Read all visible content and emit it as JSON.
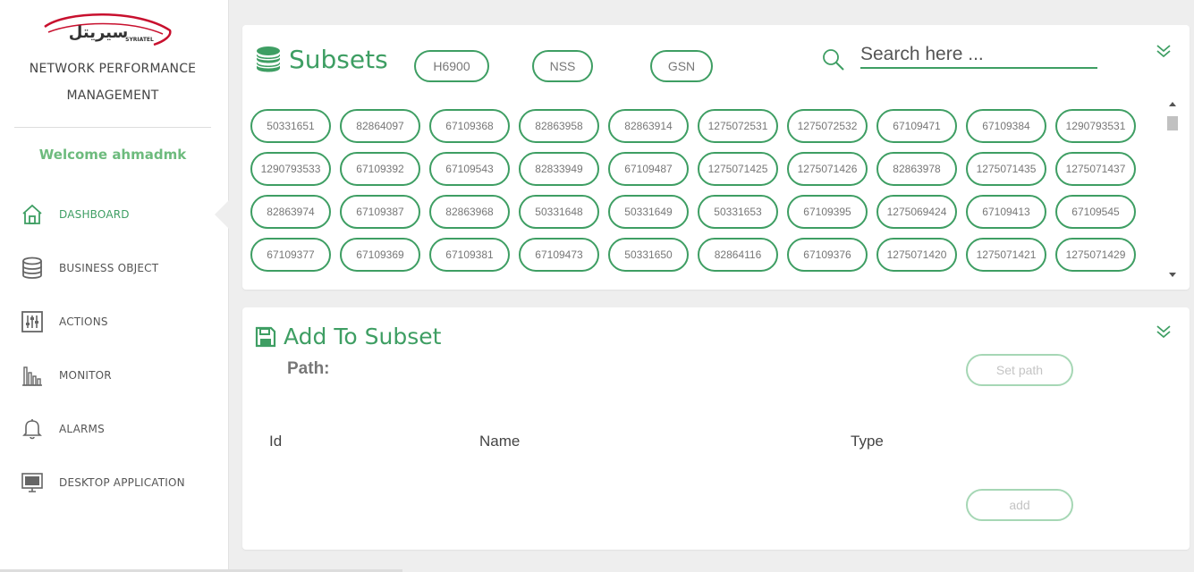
{
  "brand": {
    "logo_text": "سيريتل",
    "logo_sub": "SYRIATEL",
    "title_line1": "NETWORK PERFORMANCE",
    "title_line2": "MANAGEMENT",
    "welcome": "Welcome ahmadmk"
  },
  "sidebar": {
    "items": [
      {
        "label": "DASHBOARD",
        "icon": "home-icon",
        "active": true
      },
      {
        "label": "BUSINESS OBJECT",
        "icon": "database-icon",
        "active": false
      },
      {
        "label": "ACTIONS",
        "icon": "sliders-icon",
        "active": false
      },
      {
        "label": "MONITOR",
        "icon": "bar-chart-icon",
        "active": false
      },
      {
        "label": "ALARMS",
        "icon": "bell-icon",
        "active": false
      },
      {
        "label": "DESKTOP APPLICATION",
        "icon": "monitor-icon",
        "active": false
      }
    ]
  },
  "subsets": {
    "title": "Subsets",
    "icon": "database-icon",
    "filters": [
      "H6900",
      "NSS",
      "GSN"
    ],
    "search_placeholder": "Search here ...",
    "tags": [
      "50331651",
      "82864097",
      "67109368",
      "82863958",
      "82863914",
      "1275072531",
      "1275072532",
      "67109471",
      "67109384",
      "1290793531",
      "1290793533",
      "67109392",
      "67109543",
      "82833949",
      "67109487",
      "1275071425",
      "1275071426",
      "82863978",
      "1275071435",
      "1275071437",
      "82863974",
      "67109387",
      "82863968",
      "50331648",
      "50331649",
      "50331653",
      "67109395",
      "1275069424",
      "67109413",
      "67109545",
      "67109377",
      "67109369",
      "67109381",
      "67109473",
      "50331650",
      "82864116",
      "67109376",
      "1275071420",
      "1275071421",
      "1275071429"
    ]
  },
  "add_to_subset": {
    "title": "Add To Subset",
    "icon": "save-icon",
    "path_label": "Path:",
    "set_path_label": "Set path",
    "columns": [
      "Id",
      "Name",
      "Type"
    ],
    "add_label": "add"
  },
  "colors": {
    "accent": "#3e9e63",
    "accent_light": "#a6d7b5",
    "welcome": "#6dbb7d",
    "logo_red": "#c8102e"
  }
}
